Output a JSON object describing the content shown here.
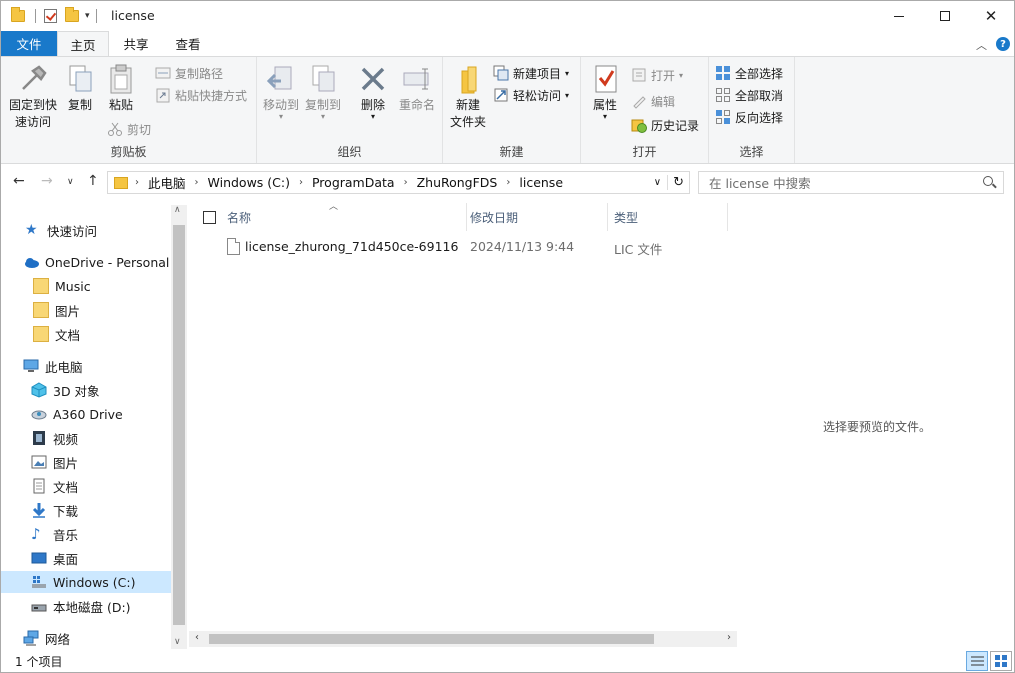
{
  "window": {
    "title": "license"
  },
  "tabs": {
    "file": "文件",
    "home": "主页",
    "share": "共享",
    "view": "查看"
  },
  "ribbon": {
    "clipboard": {
      "label": "剪贴板",
      "pin": "固定到快\n速访问",
      "pin_l1": "固定到快",
      "pin_l2": "速访问",
      "copy": "复制",
      "paste": "粘贴",
      "copy_path": "复制路径",
      "paste_shortcut": "粘贴快捷方式",
      "cut": "剪切"
    },
    "organize": {
      "label": "组织",
      "move_to": "移动到",
      "copy_to": "复制到",
      "delete": "删除",
      "rename": "重命名"
    },
    "new": {
      "label": "新建",
      "new_folder_l1": "新建",
      "new_folder_l2": "文件夹",
      "new_item": "新建项目",
      "easy_access": "轻松访问"
    },
    "open": {
      "label": "打开",
      "properties": "属性",
      "open": "打开",
      "edit": "编辑",
      "history": "历史记录"
    },
    "select": {
      "label": "选择",
      "select_all": "全部选择",
      "select_none": "全部取消",
      "invert": "反向选择"
    }
  },
  "address": {
    "crumbs": [
      "此电脑",
      "Windows (C:)",
      "ProgramData",
      "ZhuRongFDS",
      "license"
    ],
    "search_placeholder": "在 license 中搜索"
  },
  "nav": {
    "quick_access": "快速访问",
    "onedrive": "OneDrive - Personal",
    "onedrive_items": [
      "Music",
      "图片",
      "文档"
    ],
    "this_pc": "此电脑",
    "pc_items": [
      "3D 对象",
      "A360 Drive",
      "视频",
      "图片",
      "文档",
      "下载",
      "音乐",
      "桌面",
      "Windows (C:)",
      "本地磁盘 (D:)"
    ],
    "network": "网络"
  },
  "columns": {
    "name": "名称",
    "modified": "修改日期",
    "type": "类型"
  },
  "files": [
    {
      "name": "license_zhurong_71d450ce-69116a...",
      "modified": "2024/11/13 9:44",
      "type": "LIC 文件"
    }
  ],
  "preview": {
    "empty_text": "选择要预览的文件。"
  },
  "status": {
    "count": "1 个项目"
  },
  "colors": {
    "accent": "#1979ca",
    "selection": "#cce8ff",
    "folder": "#f8d775"
  }
}
